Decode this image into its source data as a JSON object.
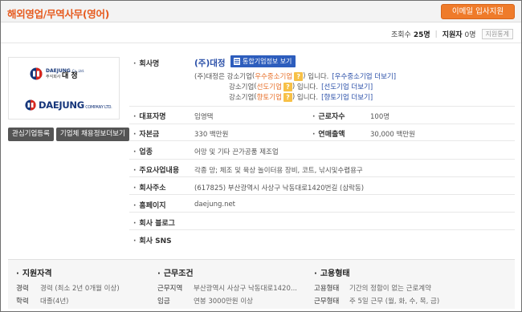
{
  "header": {
    "title": "해외영업/무역사무(영어)",
    "apply_label": "이메일 입사지원"
  },
  "stats": {
    "views_label": "조회수",
    "views": "25명",
    "applicants_label": "지원자",
    "applicants": "0명",
    "stats_button": "지원통계"
  },
  "logo": {
    "small_brand": "DAEJUNG",
    "small_suffix": "Co.,Ltd.",
    "small_kr_prefix": "주식회사",
    "small_kr_name": "대 정",
    "big_brand": "DAEJUNG",
    "big_suffix": "COMPANY LTD.",
    "colors": {
      "brand_blue": "#15357a",
      "brand_red": "#d9261c"
    }
  },
  "side_buttons": {
    "interest": "관심기업등록",
    "jobs": "기업체 채용정보더보기"
  },
  "company": {
    "name_label": "회사명",
    "name": "(주)대정",
    "corp_info_button": "통합기업정보 보기",
    "sme_intro": "(주)대정은",
    "sme_lines": [
      {
        "prefix": "강소기업",
        "tag": "우수중소기업",
        "suffix": "입니다.",
        "link": "[우수중소기업 더보기]"
      },
      {
        "prefix": "강소기업",
        "tag": "선도기업",
        "suffix": "입니다.",
        "link": "[선도기업 더보기]"
      },
      {
        "prefix": "강소기업",
        "tag": "향토기업",
        "suffix": "입니다.",
        "link": "[향토기업 더보기]"
      }
    ],
    "ceo_label": "대표자명",
    "ceo": "임영택",
    "employees_label": "근로자수",
    "employees": "100명",
    "capital_label": "자본금",
    "capital": "330 백만원",
    "sales_label": "연매출액",
    "sales": "30,000 백만원",
    "industry_label": "업종",
    "industry": "어망 및 기타 끈가공품 제조업",
    "business_label": "주요사업내용",
    "business": "각종 망; 체조 및 육상 놀이터용 장비, 코트, 낚시및수렵용구",
    "address_label": "회사주소",
    "address": "(617825) 부산광역시 사상구 낙동대로1420번길 (삼락동)",
    "homepage_label": "홈페이지",
    "homepage": "daejung.net",
    "blog_label": "회사 블로그",
    "sns_label": "회사 SNS"
  },
  "conditions": {
    "qual_title": "지원자격",
    "career_label": "경력",
    "career": "경력 (최소 2년 0개월 이상)",
    "edu_label": "학력",
    "edu": "대졸(4년)",
    "work_title": "근무조건",
    "location_label": "근무지역",
    "location": "부산광역시 사상구 낙동대로1420...",
    "wage_label": "임금",
    "wage": "연봉 3000만원 이상",
    "emp_title": "고용형태",
    "emp_label": "고용형태",
    "emp": "기간의 정함이 없는 근로계약",
    "form_label": "근무형태",
    "form": "주 5일 근무 (월, 화, 수, 목, 금)"
  }
}
